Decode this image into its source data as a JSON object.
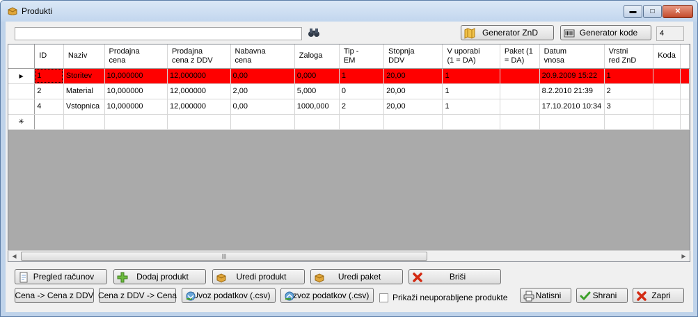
{
  "window": {
    "title": "Produkti",
    "count": "4"
  },
  "search": {
    "value": "",
    "placeholder": ""
  },
  "top_buttons": {
    "generator_znd": "Generator ZnD",
    "generator_kode": "Generator kode"
  },
  "grid": {
    "columns": [
      "ID",
      "Naziv",
      "Prodajna\ncena",
      "Prodajna\ncena z DDV",
      "Nabavna\ncena",
      "Zaloga",
      "Tip -\nEM",
      "Stopnja\nDDV",
      "V uporabi\n(1 = DA)",
      "Paket (1\n= DA)",
      "Datum\nvnosa",
      "Vrstni\nred ZnD",
      "Koda"
    ],
    "rows": [
      [
        "1",
        "Storitev",
        "10,000000",
        "12,000000",
        "0,00",
        "0,000",
        "1",
        "20,00",
        "1",
        "",
        "20.9.2009 15:22",
        "1",
        ""
      ],
      [
        "2",
        "Material",
        "10,000000",
        "12,000000",
        "2,00",
        "5,000",
        "0",
        "20,00",
        "1",
        "",
        "8.2.2010 21:39",
        "2",
        ""
      ],
      [
        "4",
        "Vstopnica",
        "10,000000",
        "12,000000",
        "0,00",
        "1000,000",
        "2",
        "20,00",
        "1",
        "",
        "17.10.2010 10:34",
        "3",
        ""
      ]
    ],
    "selected_row": 0
  },
  "buttons": {
    "pregled_racunov": "Pregled računov",
    "dodaj_produkt": "Dodaj produkt",
    "uredi_produkt": "Uredi produkt",
    "uredi_paket": "Uredi paket",
    "brisi": "Briši",
    "cena_to_ddv": "Cena -> Cena z DDV",
    "ddv_to_cena": "Cena z DDV -> Cena",
    "uvoz": "Uvoz podatkov (.csv)",
    "izvoz": "Izvoz podatkov (.csv)",
    "natisni": "Natisni",
    "shrani": "Shrani",
    "zapri": "Zapri"
  },
  "checkbox": {
    "label": "Prikaži neuporabljene produkte",
    "checked": false
  },
  "colors": {
    "selected_row": "#ff0000",
    "grid_background": "#aaaaaa"
  }
}
